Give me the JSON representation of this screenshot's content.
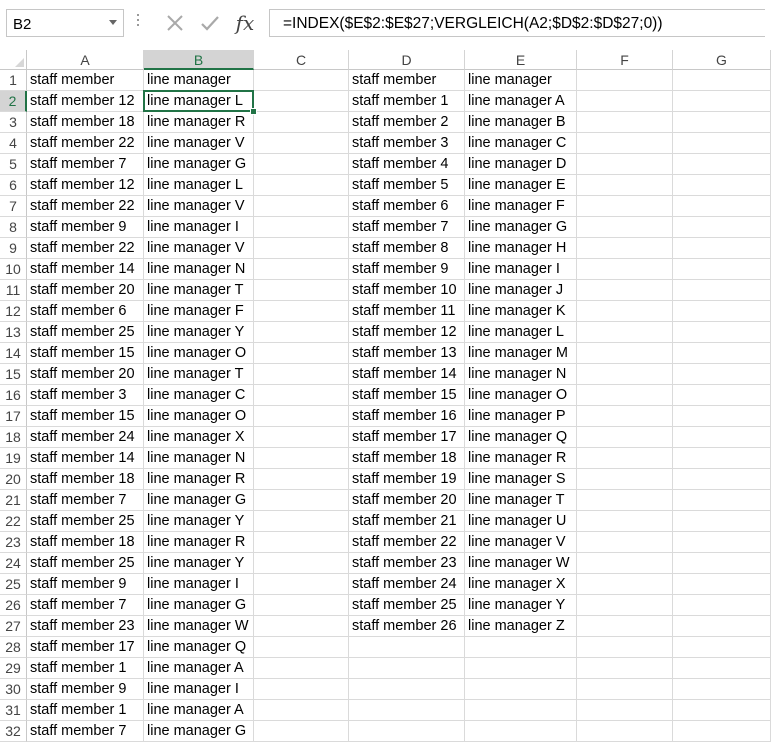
{
  "formula_bar": {
    "name_box": "B2",
    "cancel_icon": "cancel-x-icon",
    "enter_icon": "checkmark-icon",
    "fx_label": "fx",
    "formula": "=INDEX($E$2:$E$27;VERGLEICH(A2;$D$2:$D$27;0))"
  },
  "columns": [
    "A",
    "B",
    "C",
    "D",
    "E",
    "F",
    "G"
  ],
  "active_cell": {
    "col": "B",
    "row": 2
  },
  "rows": [
    {
      "n": "1",
      "A": "staff member",
      "B": "line manager",
      "D": "staff member",
      "E": "line manager"
    },
    {
      "n": "2",
      "A": "staff member 12",
      "B": "line manager L",
      "D": "staff member 1",
      "E": "line manager A"
    },
    {
      "n": "3",
      "A": "staff member 18",
      "B": "line manager R",
      "D": "staff member 2",
      "E": "line manager B"
    },
    {
      "n": "4",
      "A": "staff member 22",
      "B": "line manager V",
      "D": "staff member 3",
      "E": "line manager C"
    },
    {
      "n": "5",
      "A": "staff member 7",
      "B": "line manager G",
      "D": "staff member 4",
      "E": "line manager D"
    },
    {
      "n": "6",
      "A": "staff member 12",
      "B": "line manager L",
      "D": "staff member 5",
      "E": "line manager E"
    },
    {
      "n": "7",
      "A": "staff member 22",
      "B": "line manager V",
      "D": "staff member 6",
      "E": "line manager F"
    },
    {
      "n": "8",
      "A": "staff member 9",
      "B": "line manager I",
      "D": "staff member 7",
      "E": "line manager G"
    },
    {
      "n": "9",
      "A": "staff member 22",
      "B": "line manager V",
      "D": "staff member 8",
      "E": "line manager H"
    },
    {
      "n": "10",
      "A": "staff member 14",
      "B": "line manager N",
      "D": "staff member 9",
      "E": "line manager I"
    },
    {
      "n": "11",
      "A": "staff member 20",
      "B": "line manager T",
      "D": "staff member 10",
      "E": "line manager J"
    },
    {
      "n": "12",
      "A": "staff member 6",
      "B": "line manager F",
      "D": "staff member 11",
      "E": "line manager K"
    },
    {
      "n": "13",
      "A": "staff member 25",
      "B": "line manager Y",
      "D": "staff member 12",
      "E": "line manager L"
    },
    {
      "n": "14",
      "A": "staff member 15",
      "B": "line manager O",
      "D": "staff member 13",
      "E": "line manager M"
    },
    {
      "n": "15",
      "A": "staff member 20",
      "B": "line manager T",
      "D": "staff member 14",
      "E": "line manager N"
    },
    {
      "n": "16",
      "A": "staff member 3",
      "B": "line manager C",
      "D": "staff member 15",
      "E": "line manager O"
    },
    {
      "n": "17",
      "A": "staff member 15",
      "B": "line manager O",
      "D": "staff member 16",
      "E": "line manager P"
    },
    {
      "n": "18",
      "A": "staff member 24",
      "B": "line manager X",
      "D": "staff member 17",
      "E": "line manager Q"
    },
    {
      "n": "19",
      "A": "staff member 14",
      "B": "line manager N",
      "D": "staff member 18",
      "E": "line manager R"
    },
    {
      "n": "20",
      "A": "staff member 18",
      "B": "line manager R",
      "D": "staff member 19",
      "E": "line manager S"
    },
    {
      "n": "21",
      "A": "staff member 7",
      "B": "line manager G",
      "D": "staff member 20",
      "E": "line manager T"
    },
    {
      "n": "22",
      "A": "staff member 25",
      "B": "line manager Y",
      "D": "staff member 21",
      "E": "line manager U"
    },
    {
      "n": "23",
      "A": "staff member 18",
      "B": "line manager R",
      "D": "staff member 22",
      "E": "line manager V"
    },
    {
      "n": "24",
      "A": "staff member 25",
      "B": "line manager Y",
      "D": "staff member 23",
      "E": "line manager W"
    },
    {
      "n": "25",
      "A": "staff member 9",
      "B": "line manager I",
      "D": "staff member 24",
      "E": "line manager X"
    },
    {
      "n": "26",
      "A": "staff member 7",
      "B": "line manager G",
      "D": "staff member 25",
      "E": "line manager Y"
    },
    {
      "n": "27",
      "A": "staff member 23",
      "B": "line manager W",
      "D": "staff member 26",
      "E": "line manager Z"
    },
    {
      "n": "28",
      "A": "staff member 17",
      "B": "line manager Q"
    },
    {
      "n": "29",
      "A": "staff member 1",
      "B": "line manager A"
    },
    {
      "n": "30",
      "A": "staff member 9",
      "B": "line manager I"
    },
    {
      "n": "31",
      "A": "staff member 1",
      "B": "line manager A"
    },
    {
      "n": "32",
      "A": "staff member 7",
      "B": "line manager G"
    }
  ],
  "colors": {
    "accent": "#217346",
    "header_active": "#d4d4d4",
    "gridline": "#dadada"
  }
}
